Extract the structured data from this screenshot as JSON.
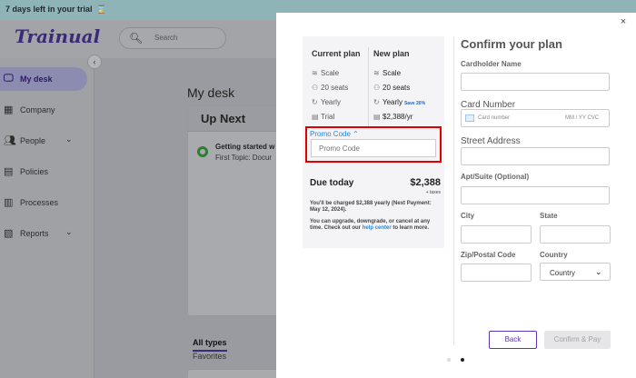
{
  "trial_bar": {
    "text": "7 days left in your trial",
    "icon": "hourglass-icon"
  },
  "app": {
    "logo": "Trainual"
  },
  "search": {
    "placeholder": "Search"
  },
  "sidebar": {
    "items": [
      {
        "label": "My desk",
        "icon": "monitor-icon",
        "active": true
      },
      {
        "label": "Company",
        "icon": "building-icon"
      },
      {
        "label": "People",
        "icon": "people-icon",
        "has_chevron": true
      },
      {
        "label": "Policies",
        "icon": "document-icon"
      },
      {
        "label": "Processes",
        "icon": "processes-icon"
      },
      {
        "label": "Reports",
        "icon": "report-icon",
        "has_chevron": true
      }
    ]
  },
  "main": {
    "title": "My desk",
    "up_next": {
      "heading": "Up Next",
      "task_title": "Getting started w",
      "task_sub": "First Topic: Docur"
    },
    "tabs": [
      "All types",
      "Favorites"
    ]
  },
  "modal": {
    "current_plan": {
      "heading": "Current plan",
      "items": [
        "Scale",
        "20 seats",
        "Yearly",
        "Trial"
      ]
    },
    "new_plan": {
      "heading": "New plan",
      "items": [
        "Scale",
        "20 seats",
        "Yearly",
        "$2,388/yr"
      ],
      "save_badge": "Save 20%"
    },
    "promo": {
      "label": "Promo Code",
      "placeholder": "Promo Code"
    },
    "due": {
      "label": "Due today",
      "amount": "$2,388",
      "taxes": "+ taxes",
      "charge_note": "You'll be charged $2,388 yearly (Next Payment: May 12, 2024).",
      "change_note_prefix": "You can upgrade, downgrade, or cancel at any time. Check out our ",
      "help_link": "help center",
      "change_note_suffix": " to learn more."
    },
    "form": {
      "title": "Confirm your plan",
      "cardholder_label": "Cardholder Name",
      "card_label": "Card Number",
      "card_placeholder": "Card number",
      "card_exp_placeholder": "MM / YY  CVC",
      "street_label": "Street Address",
      "apt_label": "Apt/Suite (Optional)",
      "city_label": "City",
      "state_label": "State",
      "zip_label": "Zip/Postal Code",
      "country_label": "Country",
      "country_value": "Country"
    },
    "buttons": {
      "back": "Back",
      "confirm": "Confirm & Pay"
    },
    "close": "×"
  },
  "colors": {
    "accent": "#5e35b1",
    "link": "#1e88e5",
    "highlight": "#e00000"
  }
}
